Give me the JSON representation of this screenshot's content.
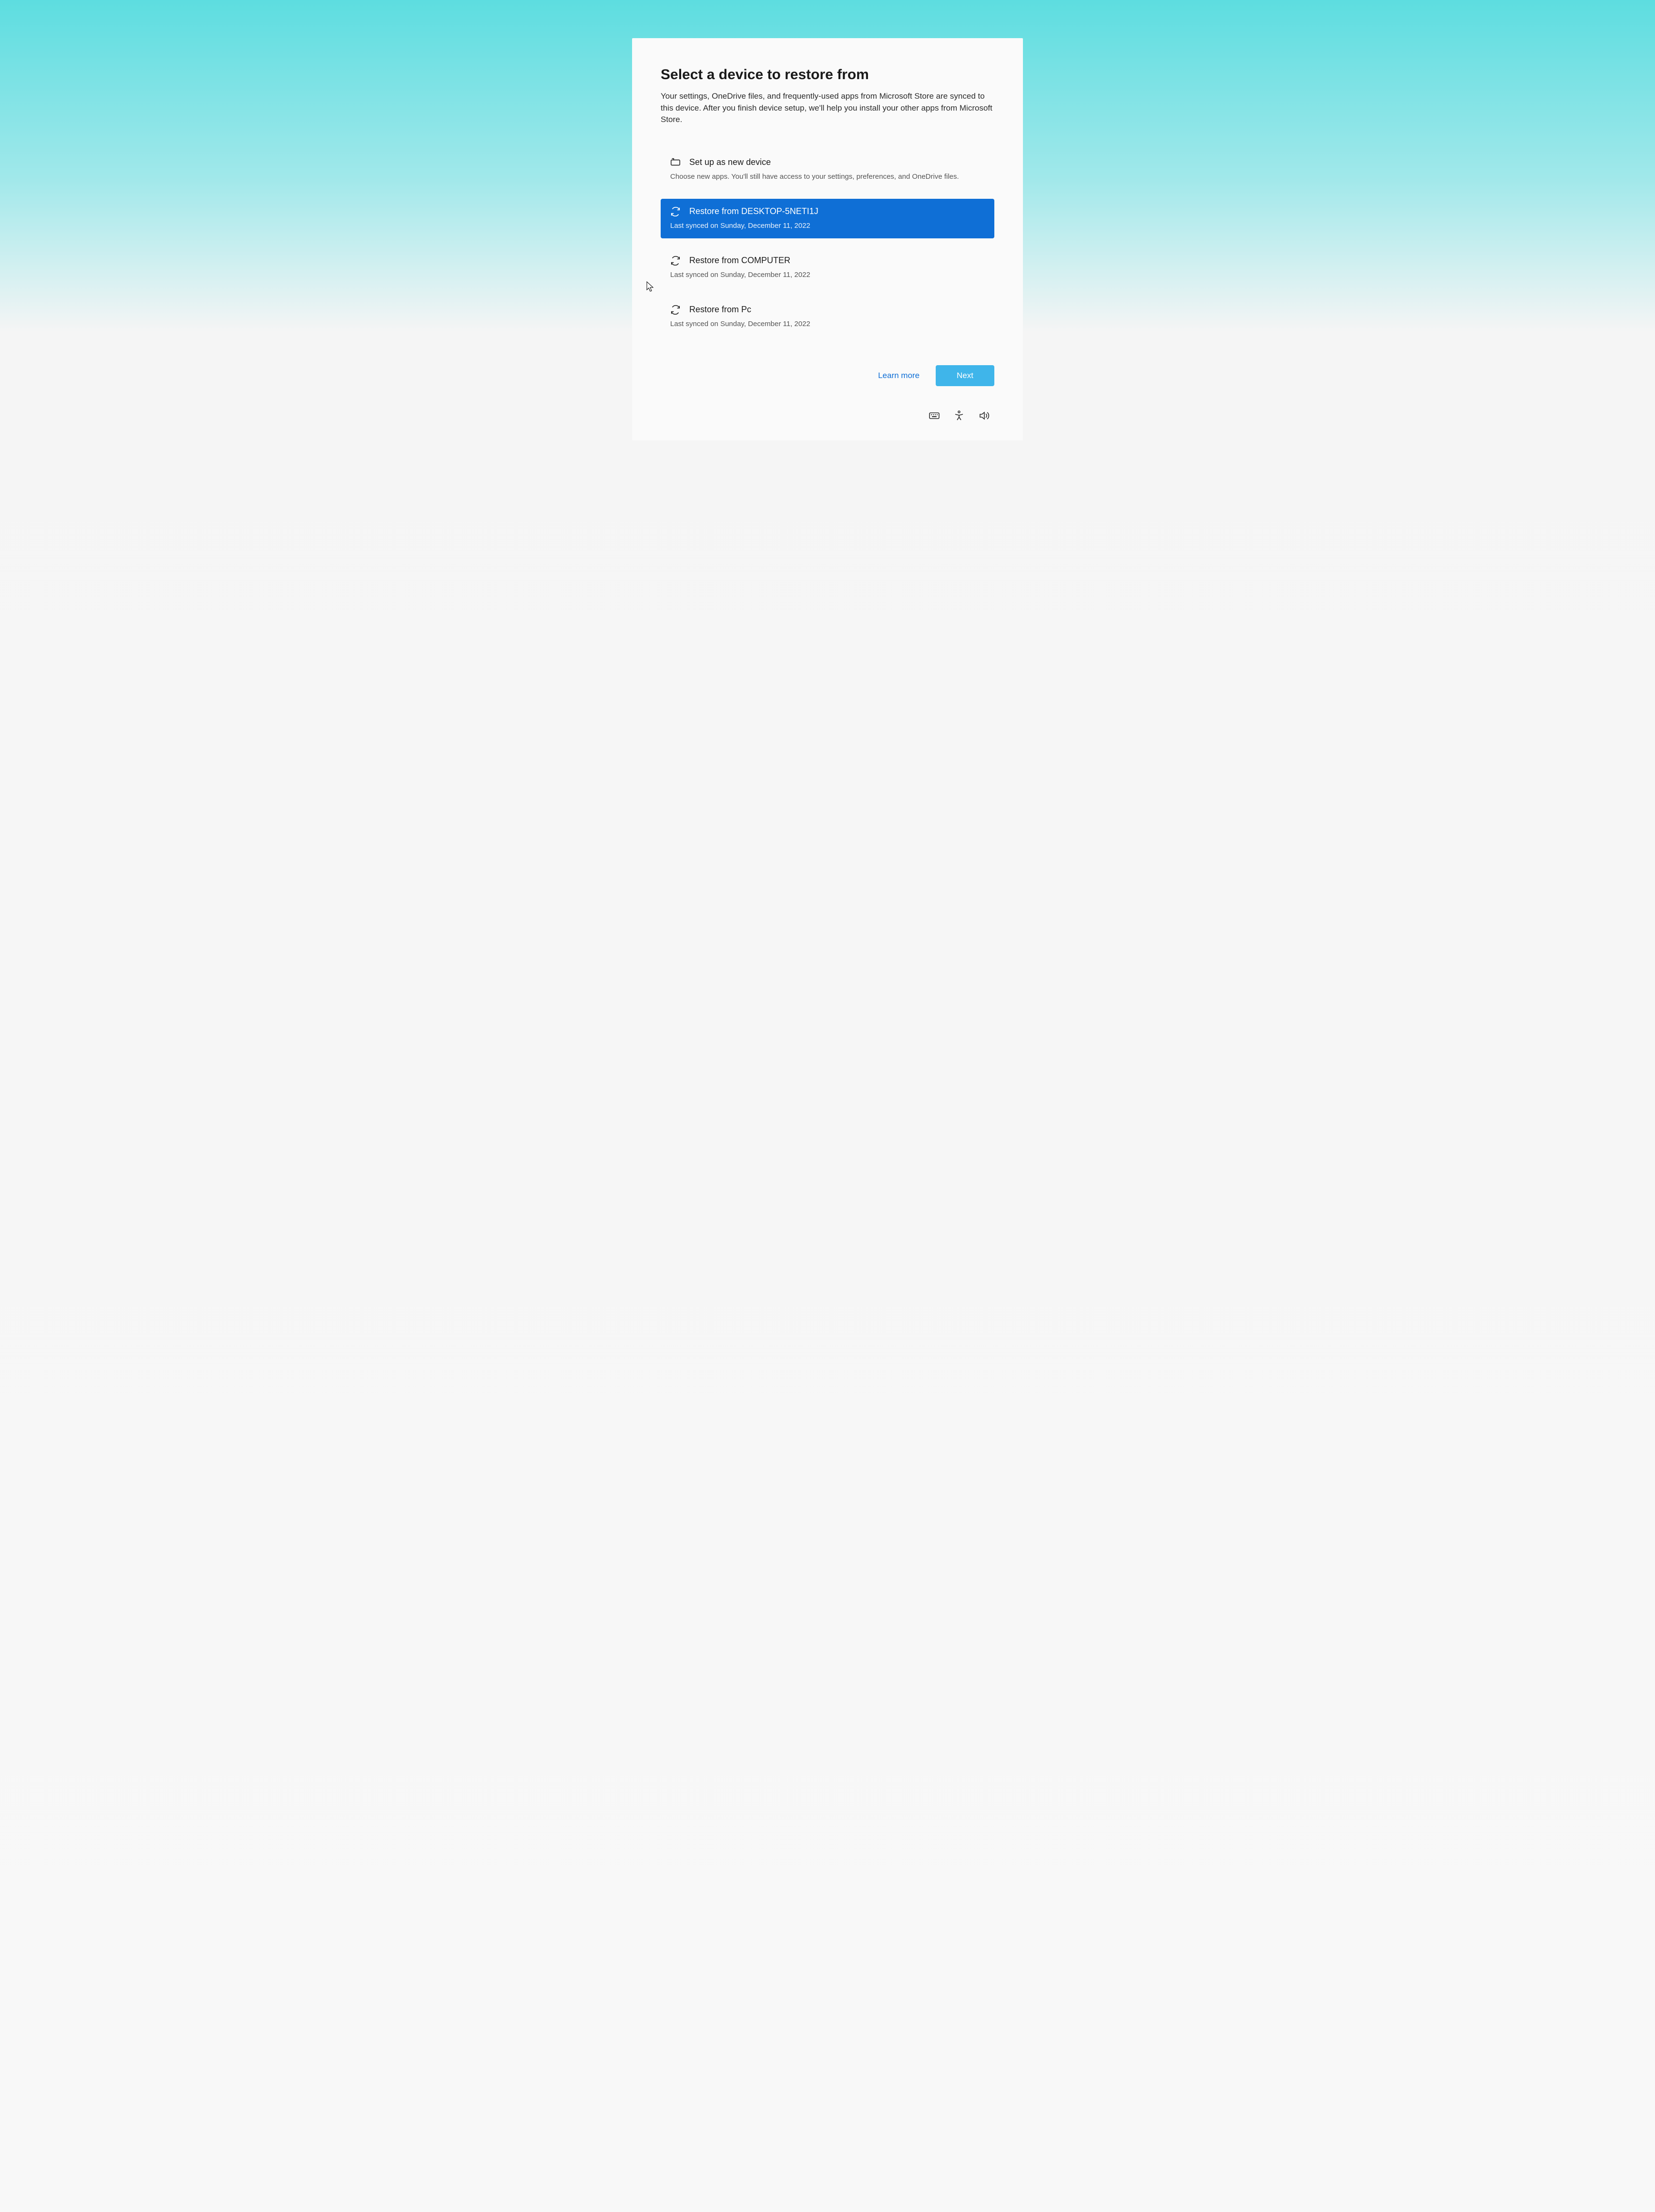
{
  "header": {
    "title": "Select a device to restore from",
    "subtitle": "Your settings, OneDrive files, and frequently-used apps from Microsoft Store are synced to this device. After you finish device setup, we'll help you install your other apps from Microsoft Store."
  },
  "options": [
    {
      "icon": "device-new-icon",
      "title": "Set up as new device",
      "sub": "Choose new apps. You'll still have access to your settings, preferences, and OneDrive files.",
      "selected": false
    },
    {
      "icon": "sync-icon",
      "title": "Restore from DESKTOP-5NETI1J",
      "sub": "Last synced on Sunday, December 11, 2022",
      "selected": true
    },
    {
      "icon": "sync-icon",
      "title": "Restore from COMPUTER",
      "sub": "Last synced on Sunday, December 11, 2022",
      "selected": false
    },
    {
      "icon": "sync-icon",
      "title": "Restore from Pc",
      "sub": "Last synced on Sunday, December 11, 2022",
      "selected": false
    }
  ],
  "footer": {
    "learn_more": "Learn more",
    "next": "Next"
  },
  "taskbar": {
    "keyboard": "keyboard-icon",
    "accessibility": "accessibility-icon",
    "volume": "volume-icon"
  }
}
